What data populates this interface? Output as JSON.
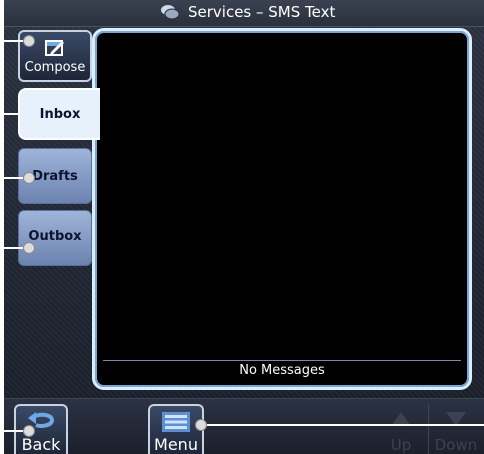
{
  "window": {
    "title": "Services – SMS Text",
    "title_icon": "chat-bubbles-icon"
  },
  "tabs": [
    {
      "id": "compose",
      "label": "Compose",
      "icon": "compose-icon",
      "selected": false
    },
    {
      "id": "inbox",
      "label": "Inbox",
      "selected": true
    },
    {
      "id": "drafts",
      "label": "Drafts",
      "selected": false
    },
    {
      "id": "outbox",
      "label": "Outbox",
      "selected": false
    }
  ],
  "panel": {
    "status_text": "No Messages"
  },
  "bottom_bar": {
    "back_label": "Back",
    "menu_label": "Menu",
    "up_label": "Up",
    "down_label": "Down",
    "up_enabled": false,
    "down_enabled": false
  },
  "colors": {
    "background": "#1f2532",
    "panel_border": "#dbeeff",
    "selected_tab": "#e6f1fb",
    "unselected_tab": "#8aa0c8",
    "disabled_text": "#3a4352"
  }
}
